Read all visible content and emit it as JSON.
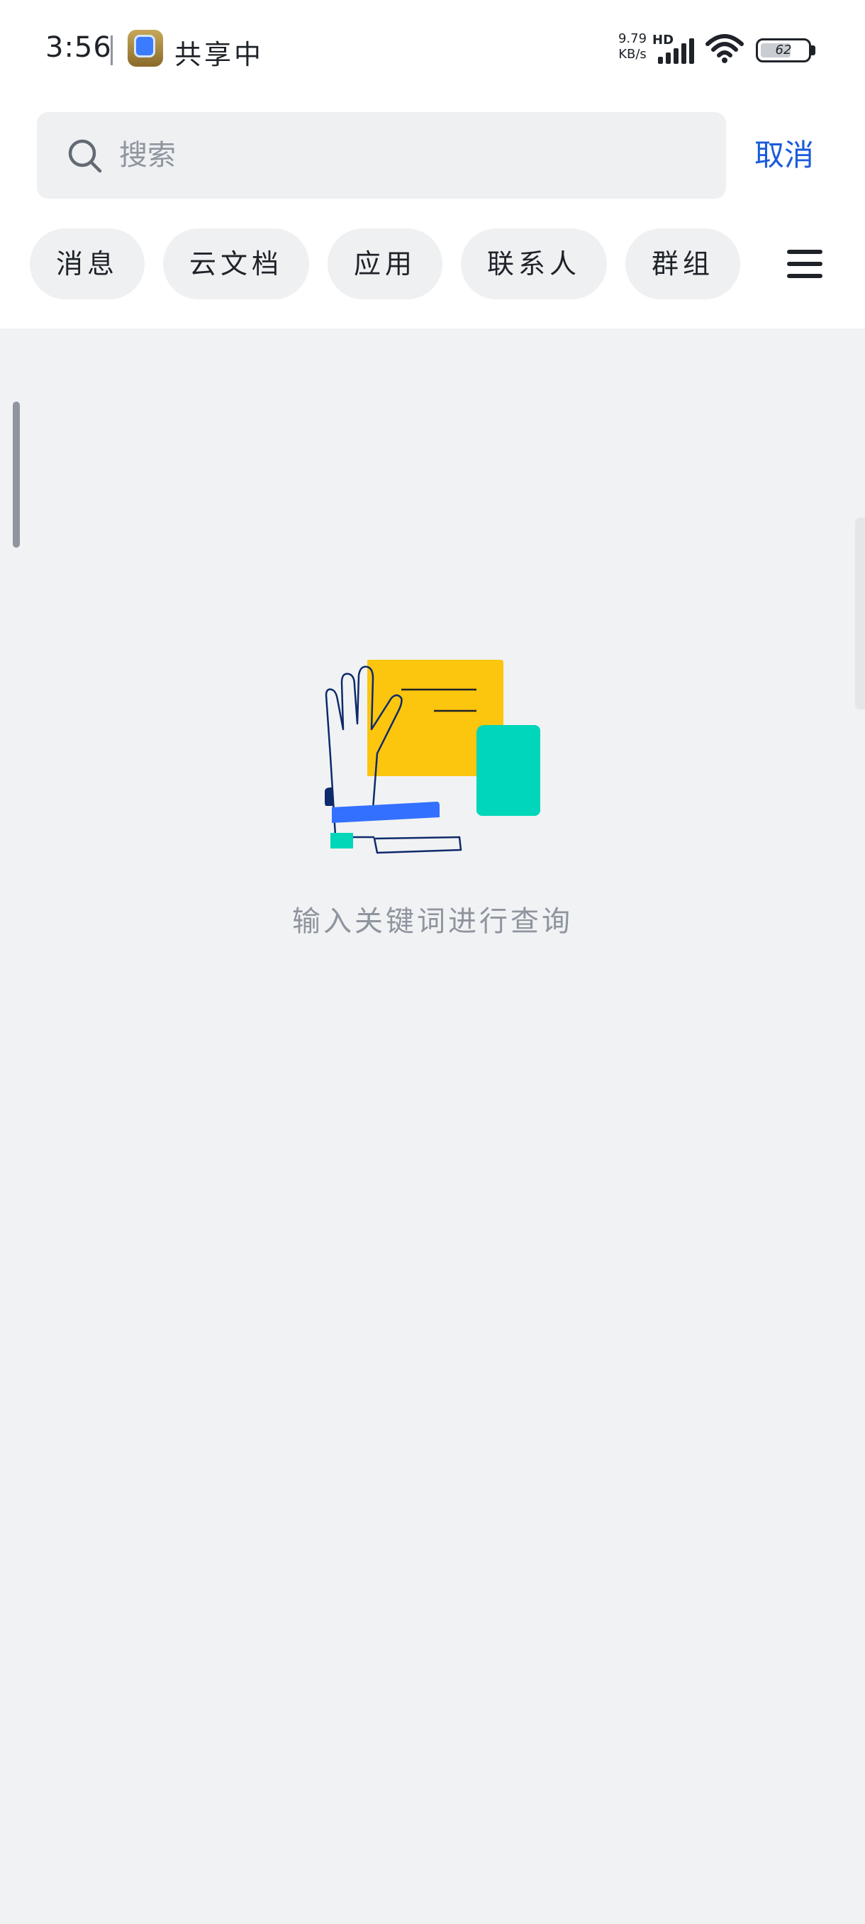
{
  "status_bar": {
    "time": "3:56",
    "sharing_text": "共享中",
    "net_speed_value": "9.79",
    "net_speed_unit": "KB/s",
    "network_type": "HD",
    "battery_percent": "62",
    "icons": [
      "app-icon",
      "signal-icon",
      "wifi-icon",
      "battery-icon"
    ]
  },
  "search": {
    "placeholder": "搜索",
    "value": "",
    "cancel_label": "取消"
  },
  "filter_chips": [
    {
      "label": "消息"
    },
    {
      "label": "云文档"
    },
    {
      "label": "应用"
    },
    {
      "label": "联系人"
    },
    {
      "label": "群组"
    }
  ],
  "empty_state": {
    "message": "输入关键词进行查询"
  },
  "colors": {
    "accent": "#1a5bdb",
    "background": "#f1f2f4",
    "chip_background": "#eef0f2",
    "illustration_yellow": "#fcc50e",
    "illustration_teal": "#00d6b9",
    "illustration_blue": "#3370ff",
    "illustration_navy": "#0e2a6b"
  }
}
